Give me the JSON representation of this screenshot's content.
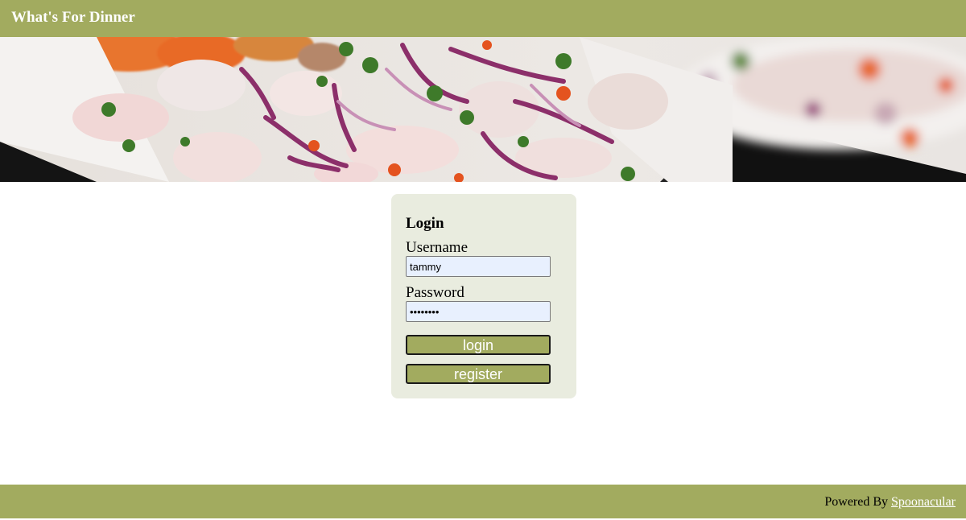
{
  "header": {
    "title": "What's For Dinner"
  },
  "hero": {
    "image_subject": "ceviche-food-photo"
  },
  "login": {
    "heading": "Login",
    "username_label": "Username",
    "username_value": "tammy",
    "password_label": "Password",
    "password_value": "********",
    "login_button": "login",
    "register_button": "register"
  },
  "footer": {
    "powered_by": "Powered By",
    "link_text": "Spoonacular"
  },
  "colors": {
    "accent": "#a2ab5f",
    "card_bg": "#e9ecdf",
    "input_bg": "#e8f0fe"
  }
}
